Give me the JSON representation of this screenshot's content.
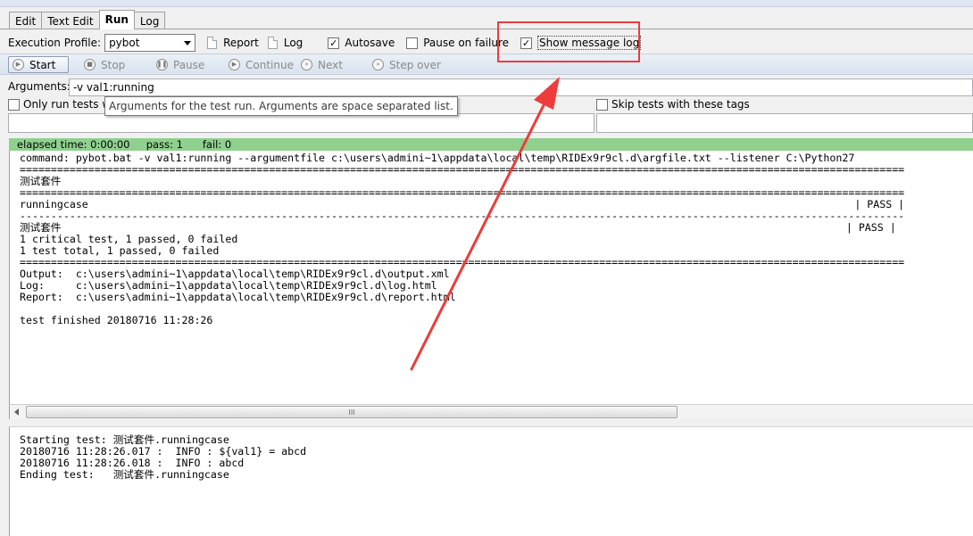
{
  "tabs": [
    {
      "label": "Edit"
    },
    {
      "label": "Text Edit"
    },
    {
      "label": "Run"
    },
    {
      "label": "Log"
    }
  ],
  "profile_row": {
    "label": "Execution Profile:",
    "selected": "pybot",
    "report_label": "Report",
    "log_label": "Log",
    "autosave_label": "Autosave",
    "autosave_checked": true,
    "pause_on_failure_label": "Pause on failure",
    "pause_on_failure_checked": false,
    "show_message_log_label": "Show message log",
    "show_message_log_checked": true
  },
  "toolbar": {
    "start": "Start",
    "stop": "Stop",
    "pause": "Pause",
    "continue": "Continue",
    "next": "Next",
    "step_over": "Step over"
  },
  "arguments": {
    "label": "Arguments:",
    "value": "-v val1:running",
    "tooltip": "Arguments for the test run. Arguments are space separated list."
  },
  "tag_filters": {
    "only_run_label": "Only run tests w",
    "skip_label": "Skip tests with these tags"
  },
  "status": {
    "text": "elapsed time: 0:00:00     pass: 1      fail: 0",
    "color": "#8fd08e"
  },
  "console_output": "command: pybot.bat -v val1:running --argumentfile c:\\users\\admini~1\\appdata\\local\\temp\\RIDEx9r9cl.d\\argfile.txt --listener C:\\Python27\n==============================================================================================================================================\n测试套件\n==============================================================================================================================================\nrunningcase                                                                                                                           | PASS |\n----------------------------------------------------------------------------------------------------------------------------------------------\n测试套件                                                                                                                              | PASS |\n1 critical test, 1 passed, 0 failed\n1 test total, 1 passed, 0 failed\n==============================================================================================================================================\nOutput:  c:\\users\\admini~1\\appdata\\local\\temp\\RIDEx9r9cl.d\\output.xml\nLog:     c:\\users\\admini~1\\appdata\\local\\temp\\RIDEx9r9cl.d\\log.html\nReport:  c:\\users\\admini~1\\appdata\\local\\temp\\RIDEx9r9cl.d\\report.html\n\ntest finished 20180716 11:28:26",
  "message_log": "Starting test: 测试套件.runningcase\n20180716 11:28:26.017 :  INFO : ${val1} = abcd\n20180716 11:28:26.018 :  INFO : abcd\nEnding test:   测试套件.runningcase",
  "scrollbar": {
    "grip": "III"
  },
  "annotation_color": "#ee3b3b"
}
